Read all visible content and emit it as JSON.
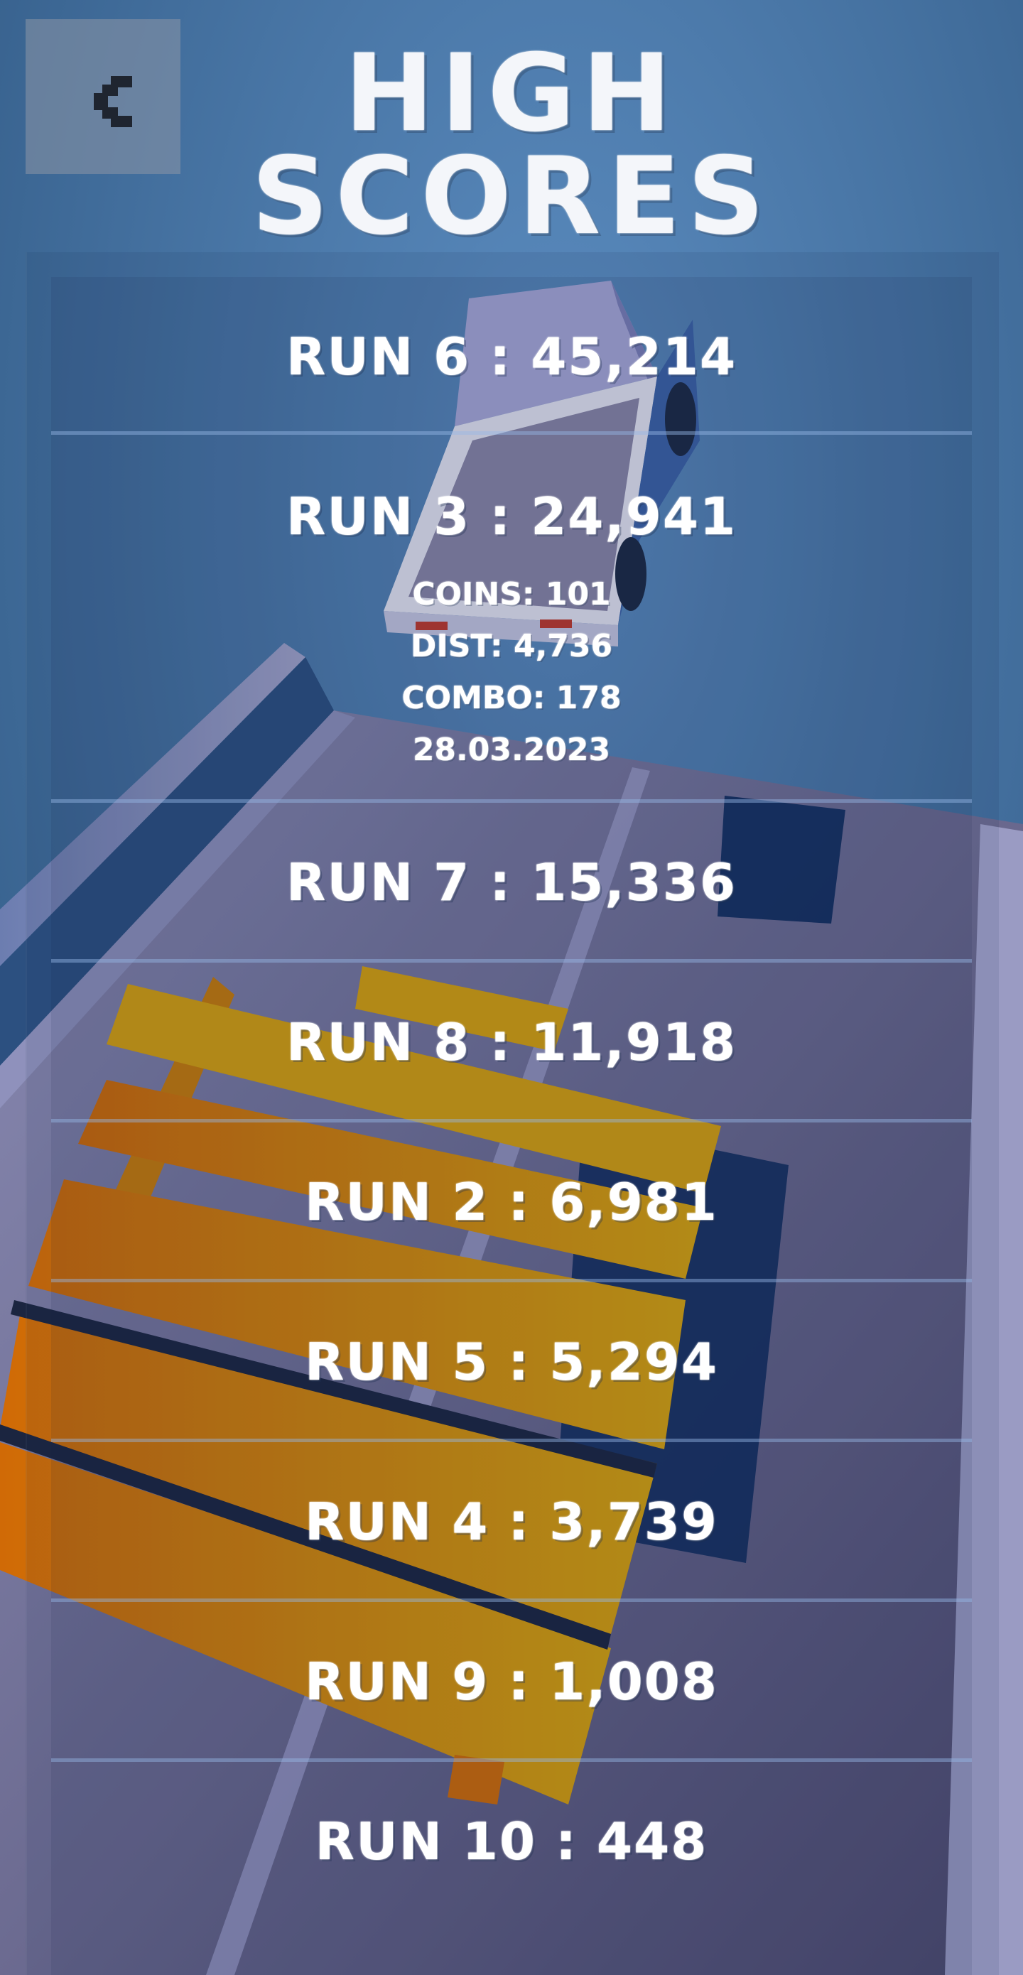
{
  "header": {
    "title_line1": "HIGH",
    "title_line2": "SCORES",
    "back_icon": "chevron-left-icon"
  },
  "scores": [
    {
      "label": "RUN 6 : 45,214"
    },
    {
      "label": "RUN 3 : 24,941"
    },
    {
      "label": "RUN 7 : 15,336"
    },
    {
      "label": "RUN 8 : 11,918"
    },
    {
      "label": "RUN 2 : 6,981"
    },
    {
      "label": "RUN 5 : 5,294"
    },
    {
      "label": "RUN 4 : 3,739"
    },
    {
      "label": "RUN 9 : 1,008"
    },
    {
      "label": "RUN 10 : 448"
    }
  ],
  "expanded_details": {
    "coins": "COINS: 101",
    "dist": "DIST: 4,736",
    "combo": "COMBO: 178",
    "date": "28.03.2023"
  },
  "colors": {
    "background": "#3d6a97",
    "road": "#7d7ea6",
    "crate": "#d6940d",
    "text": "#ffffff"
  }
}
